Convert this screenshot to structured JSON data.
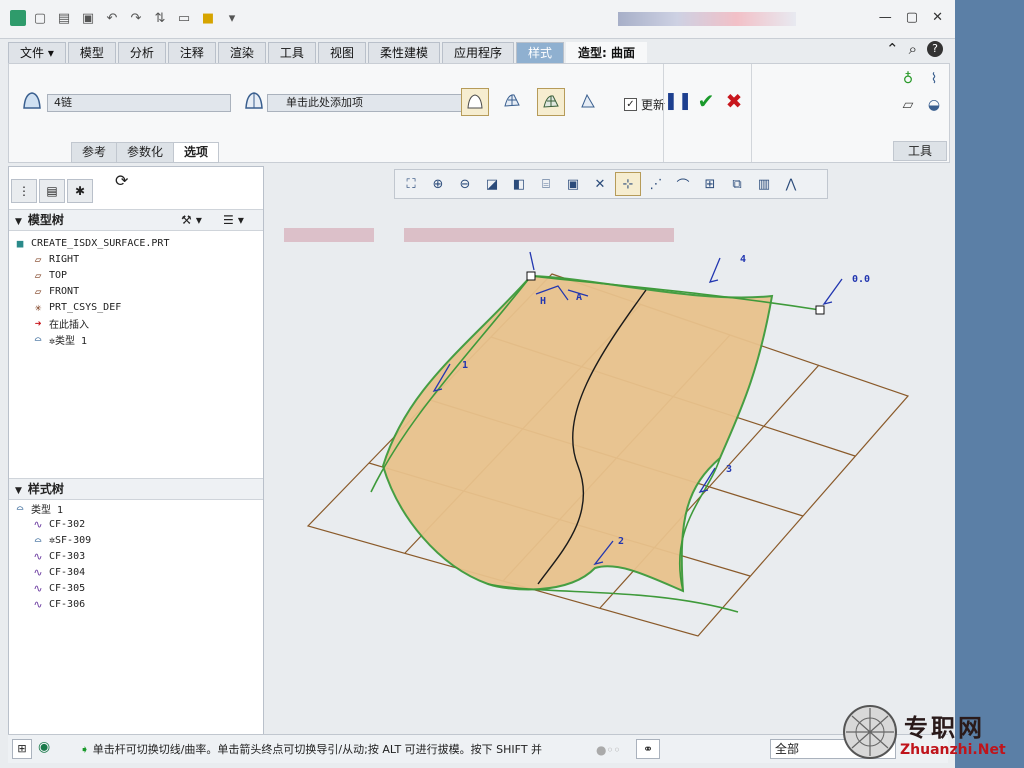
{
  "colors": {
    "accent": "#8fb0d0",
    "surface": "#e8c28c",
    "curve": "#3e9a3a",
    "grid": "#8a5a2a",
    "tag": "#2236b0"
  },
  "quick_access": {
    "icons": [
      "app-icon",
      "new-icon",
      "open-icon",
      "save-icon",
      "undo-icon",
      "redo-icon",
      "regen-icon",
      "windows-icon",
      "close-window-icon",
      "customize-icon"
    ]
  },
  "ribbon_tabs": [
    "文件",
    "模型",
    "分析",
    "注释",
    "渲染",
    "工具",
    "视图",
    "柔性建模",
    "应用程序",
    "样式"
  ],
  "active_context_label": "造型: 曲面",
  "ribbon": {
    "chain_field": "4链",
    "add_item_field": "单击此处添加项",
    "update_label": "更新",
    "update_checked": "✓",
    "subtabs": [
      "参考",
      "参数化",
      "选项"
    ],
    "active_subtab": "选项",
    "tools_label": "工具"
  },
  "model_tree": {
    "title": "模型树",
    "items": [
      {
        "icon": "part-icon",
        "label": "CREATE_ISDX_SURFACE.PRT"
      },
      {
        "icon": "datum-plane-icon",
        "label": "RIGHT"
      },
      {
        "icon": "datum-plane-icon",
        "label": "TOP"
      },
      {
        "icon": "datum-plane-icon",
        "label": "FRONT"
      },
      {
        "icon": "csys-icon",
        "label": "PRT_CSYS_DEF"
      },
      {
        "icon": "insert-arrow-icon",
        "label": "在此插入"
      },
      {
        "icon": "style-feature-icon",
        "label": "✲类型 1"
      }
    ]
  },
  "style_tree": {
    "title": "样式树",
    "items": [
      {
        "icon": "style-feature-icon",
        "label": "类型 1"
      },
      {
        "icon": "curve-icon",
        "label": "CF-302"
      },
      {
        "icon": "surface-icon",
        "label": "✲SF-309"
      },
      {
        "icon": "curve-icon",
        "label": "CF-303"
      },
      {
        "icon": "curve-icon",
        "label": "CF-304"
      },
      {
        "icon": "curve-icon",
        "label": "CF-305"
      },
      {
        "icon": "curve-icon",
        "label": "CF-306"
      }
    ]
  },
  "graphics": {
    "curve_tags": [
      "1",
      "2",
      "3",
      "4",
      "0.0"
    ],
    "handle_labels": [
      "H",
      "A"
    ]
  },
  "status": {
    "message": "单击杆可切换切线/曲率。单击箭头终点可切换导引/从动;按 ALT 可进行拔模。按下 SHIFT 并",
    "filter_value": "全部"
  },
  "watermark": {
    "main": "专职网",
    "sub": "Zhuanzhi.Net"
  }
}
